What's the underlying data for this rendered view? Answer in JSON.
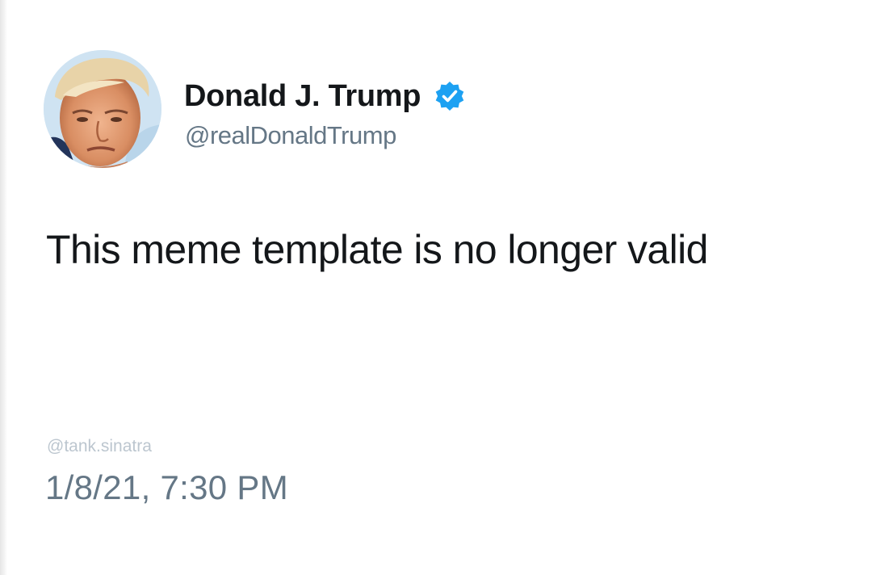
{
  "tweet": {
    "display_name": "Donald J. Trump",
    "handle": "@realDonaldTrump",
    "verified": true,
    "text": "This meme template is no longer valid",
    "watermark": "@tank.sinatra",
    "timestamp": "1/8/21, 7:30 PM"
  },
  "icons": {
    "avatar": "profile-photo",
    "verified": "verified-badge-icon"
  },
  "colors": {
    "background": "#ffffff",
    "text_primary": "#14171a",
    "text_secondary": "#657786",
    "verified_blue": "#1da1f2",
    "watermark": "#bcc6cf"
  }
}
